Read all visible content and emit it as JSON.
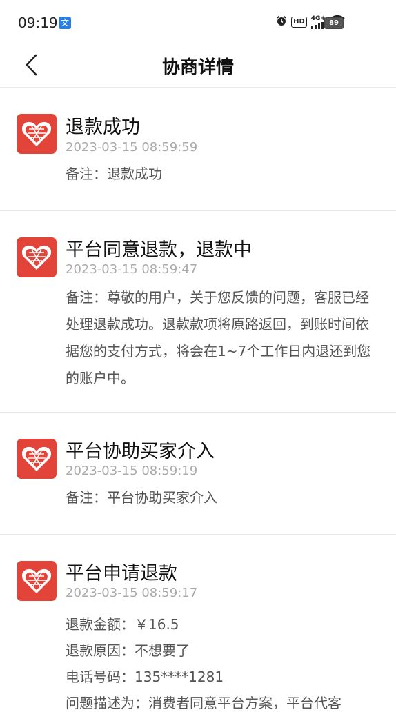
{
  "status_bar": {
    "time": "09:19",
    "app_icon": "文",
    "indicators": [
      "alarm-icon",
      "HD",
      "4G+",
      "signal-icon",
      "wifi-icon"
    ],
    "hd_label": "HD",
    "network_label": "4G+",
    "battery": "89"
  },
  "header": {
    "title": "协商详情"
  },
  "entries": [
    {
      "title": "退款成功",
      "time": "2023-03-15 08:59:59",
      "note": "备注：退款成功"
    },
    {
      "title": "平台同意退款，退款中",
      "time": "2023-03-15 08:59:47",
      "note": "备注：尊敬的用户，关于您反馈的问题，客服已经处理退款成功。退款款项将原路返回，到账时间依据您的支付方式，将会在1~7个工作日内退还到您的账户中。"
    },
    {
      "title": "平台协助买家介入",
      "time": "2023-03-15 08:59:19",
      "note": "备注：平台协助买家介入"
    },
    {
      "title": "平台申请退款",
      "time": "2023-03-15 08:59:17",
      "lines": [
        "退款金额：￥16.5",
        "退款原因：不想要了",
        "电话号码：135****1281",
        "问题描述为：消费者同意平台方案，平台代客"
      ]
    }
  ],
  "colors": {
    "logo_red": "#e3443a",
    "title_text": "#111111",
    "time_text": "#aaaaaa",
    "note_text": "#555555"
  }
}
